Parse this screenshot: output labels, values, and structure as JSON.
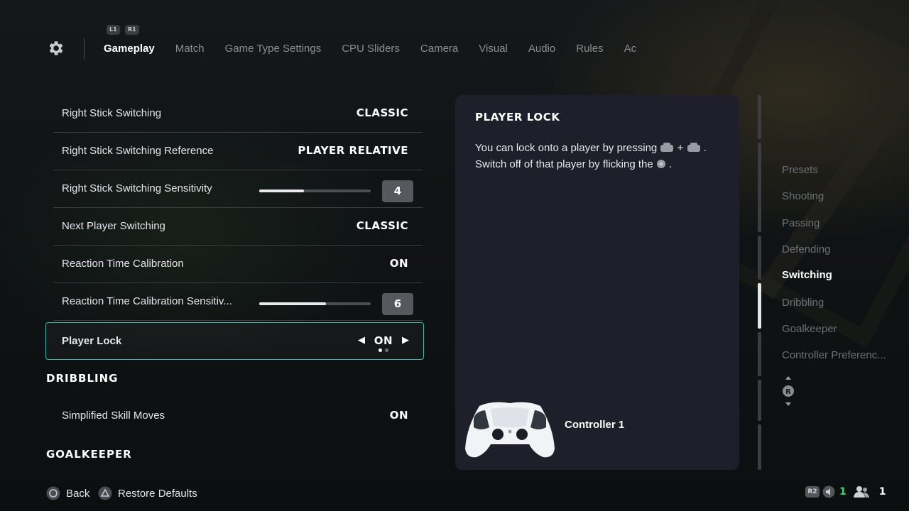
{
  "nav": {
    "bumper_left": "L1",
    "bumper_right": "R1",
    "tabs": [
      {
        "label": "Gameplay",
        "active": true
      },
      {
        "label": "Match"
      },
      {
        "label": "Game Type Settings"
      },
      {
        "label": "CPU Sliders"
      },
      {
        "label": "Camera"
      },
      {
        "label": "Visual"
      },
      {
        "label": "Audio"
      },
      {
        "label": "Rules"
      },
      {
        "label": "Ac"
      }
    ]
  },
  "settings": {
    "rows": [
      {
        "label": "Right Stick Switching",
        "value": "CLASSIC"
      },
      {
        "label": "Right Stick Switching Reference",
        "value": "PLAYER RELATIVE"
      },
      {
        "label": "Right Stick Switching Sensitivity",
        "value": "4",
        "slider_fraction": 0.4
      },
      {
        "label": "Next Player Switching",
        "value": "CLASSIC"
      },
      {
        "label": "Reaction Time Calibration",
        "value": "ON"
      },
      {
        "label": "Reaction Time Calibration Sensitiv...",
        "value": "6",
        "slider_fraction": 0.6
      },
      {
        "label": "Player Lock",
        "value": "ON",
        "selected": true,
        "option_index": 0,
        "option_count": 2
      }
    ],
    "section_dribbling": "DRIBBLING",
    "dribbling_rows": [
      {
        "label": "Simplified Skill Moves",
        "value": "ON"
      }
    ],
    "section_goalkeeper": "GOALKEEPER"
  },
  "panel": {
    "title": "PLAYER LOCK",
    "line1_prefix": "You can lock onto a player by pressing",
    "line1_plus": "+",
    "line1_suffix": ".",
    "line2_prefix": "Switch off of that player by flicking the",
    "line2_suffix": ".",
    "controller_label": "Controller 1"
  },
  "categories": [
    {
      "label": "Presets"
    },
    {
      "label": "Shooting"
    },
    {
      "label": "Passing"
    },
    {
      "label": "Defending"
    },
    {
      "label": "Switching",
      "active": true
    },
    {
      "label": "Dribbling"
    },
    {
      "label": "Goalkeeper"
    },
    {
      "label": "Controller Preferenc..."
    }
  ],
  "footer": {
    "back_label": "Back",
    "restore_label": "Restore Defaults",
    "r2_label": "R2",
    "voice_count": "1",
    "players_count": "1"
  },
  "colors": {
    "accent": "#3fb7a8",
    "panel_bg": "#1e1f2a",
    "voice_count": "#3fd070"
  }
}
